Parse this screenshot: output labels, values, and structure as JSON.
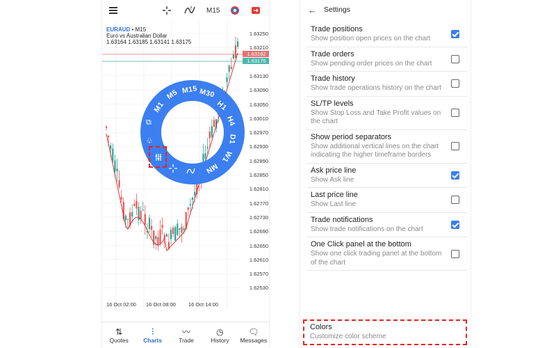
{
  "left": {
    "toolbar": {
      "timeframe": "M15",
      "icons": [
        "menu-icon",
        "crosshair-icon",
        "indicators-icon",
        "timeframe",
        "object-icon",
        "trade-icon"
      ]
    },
    "chart": {
      "symbol": "EURAUD",
      "timeframe_suffix": " • M15",
      "description": "Euro vs Australian Dollar",
      "ohlc": "1.63164 1.63185 1.63141 1.63175",
      "price_ticks": [
        "1.63250",
        "1.63210",
        "1.63170",
        "1.63130",
        "1.63090",
        "1.63050",
        "1.63010",
        "1.62970",
        "1.62930",
        "1.62890",
        "1.62850",
        "1.62810",
        "1.62770",
        "1.62730",
        "1.62690",
        "1.62650",
        "1.62610",
        "1.62570",
        "1.62530"
      ],
      "ask_tag": "1.63192",
      "bid_tag": "1.63175",
      "time_labels": [
        "16 Oct 02:00",
        "16 Oct 08:00",
        "16 Oct 14:00"
      ],
      "colors": {
        "bull": "#26a69a",
        "bear": "#ef5350",
        "ma": "#e02020",
        "ask_line": "#e57373",
        "bid_line": "#4db6ac"
      }
    },
    "timeframe_wheel": {
      "labels": [
        "M1",
        "M5",
        "M15",
        "M30",
        "H1",
        "H4",
        "D1",
        "W1",
        "MN"
      ],
      "icons": [
        "copy-icon",
        "objects-icon",
        "settings-sliders-icon",
        "crosshair-icon",
        "indicators-icon"
      ],
      "color": "#3b7ff0"
    },
    "bottom_nav": [
      {
        "label": "Quotes",
        "icon": "⇅",
        "active": false
      },
      {
        "label": "Charts",
        "icon": "⫶",
        "active": true
      },
      {
        "label": "Trade",
        "icon": "〰",
        "active": false
      },
      {
        "label": "History",
        "icon": "◷",
        "active": false
      },
      {
        "label": "Messages",
        "icon": "🗨",
        "active": false
      }
    ]
  },
  "right": {
    "header": {
      "title": "Settings"
    },
    "settings": [
      {
        "title": "Trade positions",
        "desc": "Show position open prices on the chart",
        "checked": true
      },
      {
        "title": "Trade orders",
        "desc": "Show pending order prices on the chart",
        "checked": false
      },
      {
        "title": "Trade history",
        "desc": "Show trade operations history on the chart",
        "checked": false
      },
      {
        "title": "SL/TP levels",
        "desc": "Show Stop Loss and Take Profit values on the chart",
        "checked": false
      },
      {
        "title": "Show period separators",
        "desc": "Show additional vertical lines on the chart indicating the higher timeframe borders",
        "checked": false
      },
      {
        "title": "Ask price line",
        "desc": "Show Ask line",
        "checked": true
      },
      {
        "title": "Last price line",
        "desc": "Show Last line",
        "checked": false
      },
      {
        "title": "Trade notifications",
        "desc": "Show trade notifications on the chart",
        "checked": true
      },
      {
        "title": "One Click panel at the bottom",
        "desc": "Show one click trading panel at the bottom of the chart",
        "checked": false
      }
    ],
    "colors_item": {
      "title": "Colors",
      "desc": "Customize color scheme"
    }
  }
}
